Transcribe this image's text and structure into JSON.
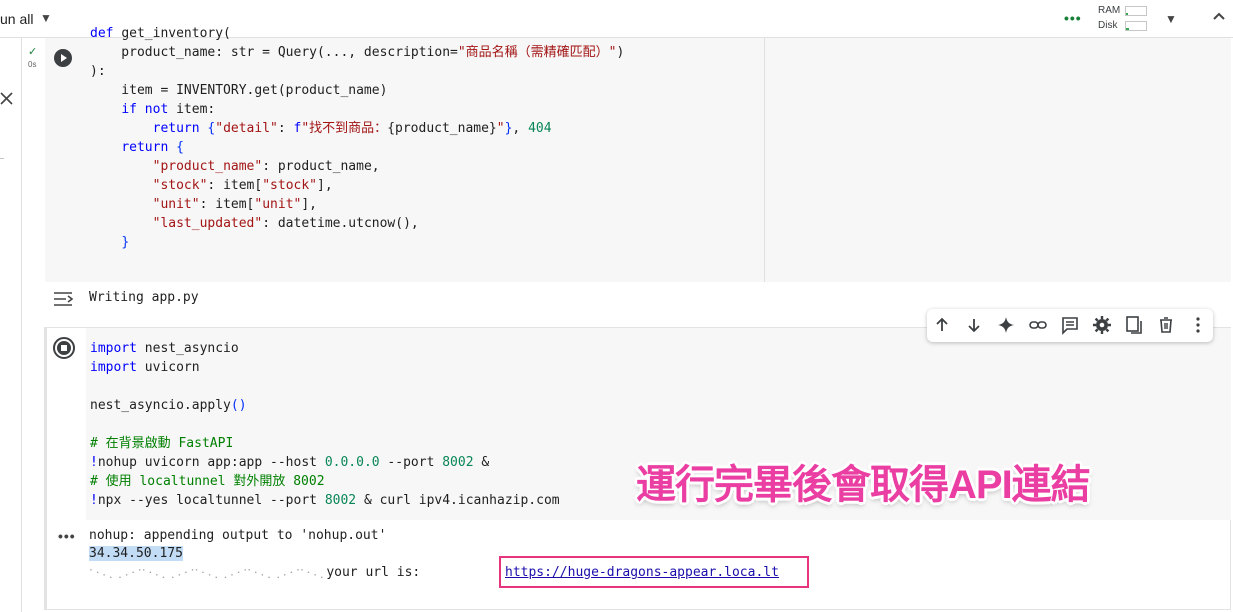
{
  "toolbar": {
    "run_all_label": "un all"
  },
  "resources": {
    "ram_label": "RAM",
    "disk_label": "Disk",
    "ram_usage": 0.1,
    "disk_usage": 0.15
  },
  "cell1": {
    "exec_status": "✓",
    "exec_time": "0s",
    "code_lines": [
      "def get_inventory(",
      "    product_name: str = Query(..., description=\"商品名稱（需精確匹配）\")",
      "):",
      "    item = INVENTORY.get(product_name)",
      "    if not item:",
      "        return {\"detail\": f\"找不到商品：{product_name}\"}, 404",
      "    return {",
      "        \"product_name\": product_name,",
      "        \"stock\": item[\"stock\"],",
      "        \"unit\": item[\"unit\"],",
      "        \"last_updated\": datetime.utcnow(),",
      "    }"
    ],
    "output": "Writing app.py"
  },
  "cell2": {
    "code_lines": [
      "import nest_asyncio",
      "import uvicorn",
      "",
      "nest_asyncio.apply()",
      "",
      "# 在背景啟動 FastAPI",
      "!nohup uvicorn app:app --host 0.0.0.0 --port 8002 &",
      "# 使用 localtunnel 對外開放 8002",
      "!npx --yes localtunnel --port 8002 & curl ipv4.icanhazip.com"
    ],
    "annotation": "運行完畢後會取得API連結",
    "output": {
      "line1": "nohup: appending output to 'nohup.out'",
      "ip": "34.34.50.175",
      "garbled": "⠁⠂⠄⡀⢀⠠⠐⠈⠁⠂⠄⡀⢀⠠⠐⠈⠁⠂⠄⡀⢀⠠⠐⠈⠁⠂⠄⡀⢀⠠⠐⠈⠁⠂⠄⡀",
      "url_prefix": "your url is: ",
      "url": "https://huge-dragons-appear.loca.lt"
    }
  },
  "accent": {
    "annotation_color": "#ea3ea3",
    "box_color": "#e8337d",
    "status_green": "#188038"
  }
}
